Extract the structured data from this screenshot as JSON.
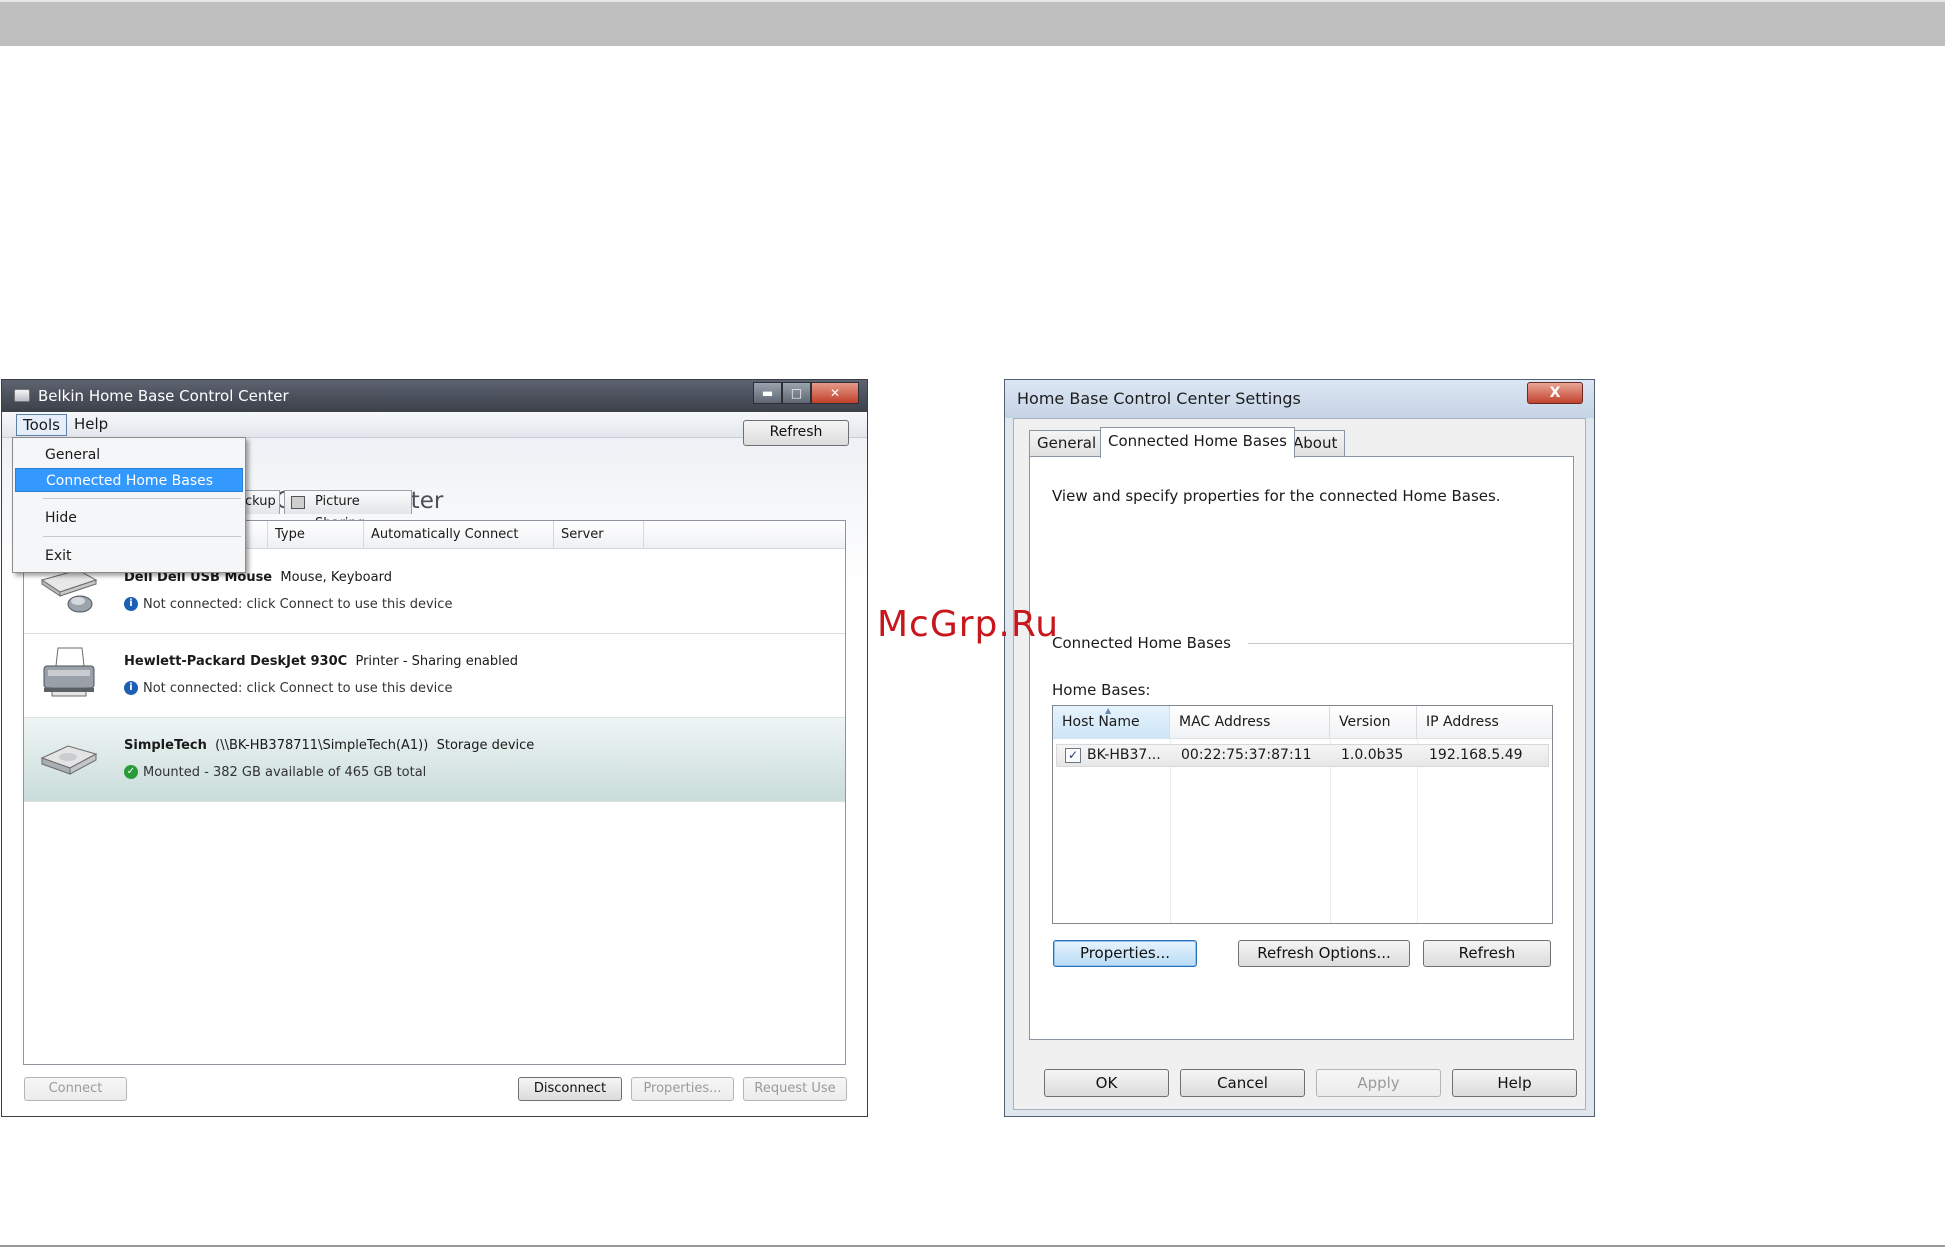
{
  "watermark": "McGrp.Ru",
  "window1": {
    "title": "Belkin Home Base Control Center",
    "menu": {
      "tools": "Tools",
      "help": "Help"
    },
    "dropdown": {
      "items": [
        "General",
        "Connected Home Bases",
        "Hide",
        "Exit"
      ],
      "highlighted": "Connected Home Bases"
    },
    "app_title": "se Control Center",
    "refresh_label": "Refresh",
    "tabs": {
      "backup": "ckup",
      "pictures": "Picture Sharing"
    },
    "columns": [
      "Type",
      "Automatically Connect",
      "Server"
    ],
    "devices": [
      {
        "name": "Dell Dell USB Mouse",
        "detail": "Mouse, Keyboard",
        "status": "Not connected: click Connect to use this device",
        "icon": "mouse-keyboard-icon",
        "status_icon": "info-icon"
      },
      {
        "name": "Hewlett-Packard DeskJet 930C",
        "detail": "Printer - Sharing enabled",
        "status": "Not connected: click Connect to use this device",
        "icon": "printer-icon",
        "status_icon": "info-icon"
      },
      {
        "name": "SimpleTech",
        "path": "(\\\\BK-HB378711\\SimpleTech(A1))",
        "detail": "Storage device",
        "status": "Mounted - 382 GB available of 465 GB total",
        "icon": "hard-drive-icon",
        "status_icon": "check-icon"
      }
    ],
    "buttons": {
      "connect": "Connect",
      "disconnect": "Disconnect",
      "properties": "Properties...",
      "request_use": "Request Use"
    }
  },
  "window2": {
    "title": "Home Base Control Center Settings",
    "close": "X",
    "tabs": [
      "General",
      "Connected Home Bases",
      "About"
    ],
    "active_tab": "Connected Home Bases",
    "description": "View and specify properties for the connected Home Bases.",
    "group_label": "Connected Home Bases",
    "list_label": "Home Bases:",
    "columns": [
      "Host Name",
      "MAC Address",
      "Version",
      "IP Address"
    ],
    "rows": [
      {
        "checked": true,
        "host": "BK-HB37...",
        "mac": "00:22:75:37:87:11",
        "version": "1.0.0b35",
        "ip": "192.168.5.49"
      }
    ],
    "buttons": {
      "properties": "Properties...",
      "refresh_options": "Refresh Options...",
      "refresh": "Refresh"
    },
    "dialog_buttons": {
      "ok": "OK",
      "cancel": "Cancel",
      "apply": "Apply",
      "help": "Help"
    }
  }
}
